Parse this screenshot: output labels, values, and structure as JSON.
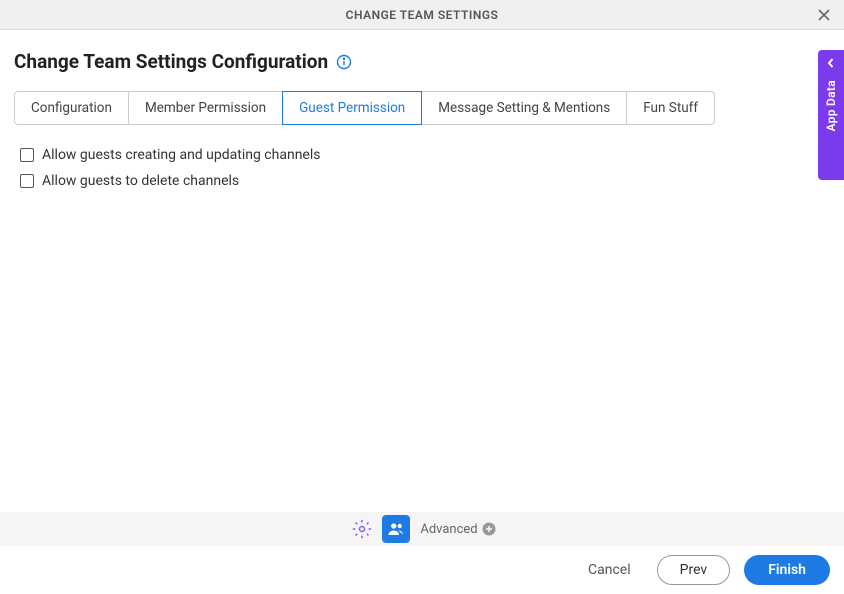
{
  "header": {
    "title": "CHANGE TEAM SETTINGS"
  },
  "page": {
    "title": "Change Team Settings Configuration"
  },
  "tabs": [
    {
      "label": "Configuration",
      "active": false
    },
    {
      "label": "Member Permission",
      "active": false
    },
    {
      "label": "Guest Permission",
      "active": true
    },
    {
      "label": "Message Setting & Mentions",
      "active": false
    },
    {
      "label": "Fun Stuff",
      "active": false
    }
  ],
  "checkboxes": [
    {
      "label": "Allow guests creating and updating channels",
      "checked": false
    },
    {
      "label": "Allow guests to delete channels",
      "checked": false
    }
  ],
  "toolbar": {
    "advanced_label": "Advanced"
  },
  "footer": {
    "cancel": "Cancel",
    "prev": "Prev",
    "finish": "Finish"
  },
  "sidepanel": {
    "label": "App Data"
  }
}
